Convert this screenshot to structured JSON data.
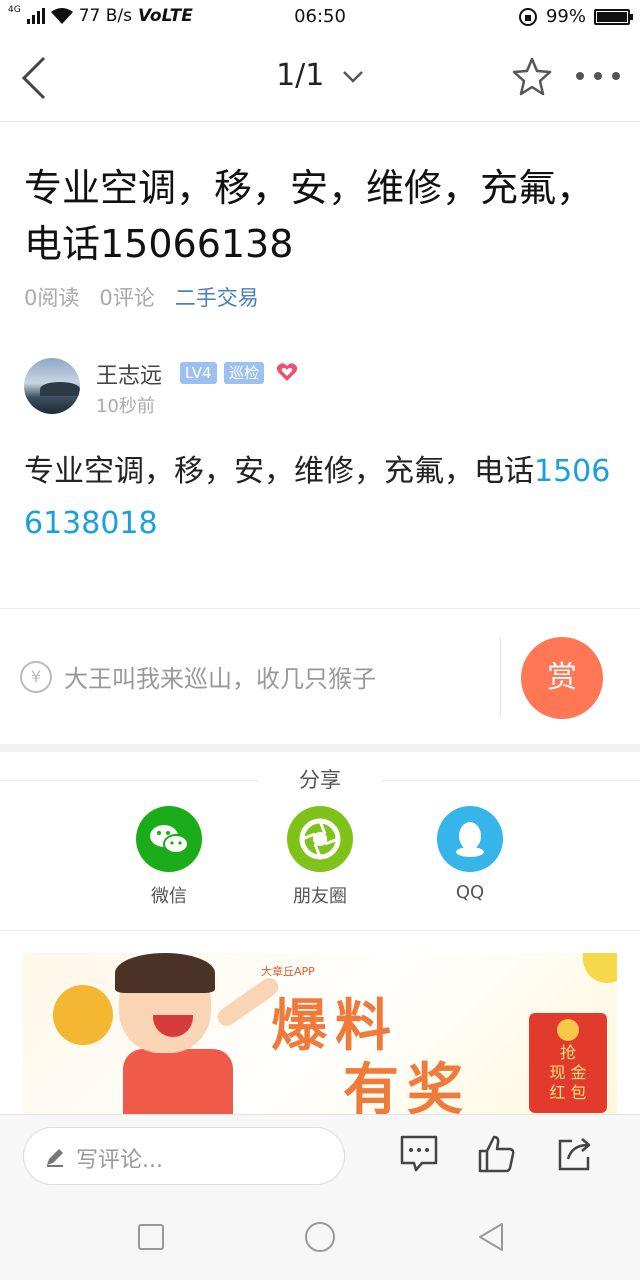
{
  "status_bar": {
    "network": "4G",
    "speed": "77 B/s",
    "volte": "VoLTE",
    "time": "06:50",
    "battery": "99%",
    "battery_level": 0.99
  },
  "header": {
    "pager": "1/1"
  },
  "article": {
    "title": "专业空调，移，安，维修，充氟，电话15066138",
    "reads": "0阅读",
    "comments": "0评论",
    "category": "二手交易",
    "author": {
      "name": "王志远",
      "level": "LV4",
      "role": "巡检",
      "time": "10秒前"
    },
    "content_text": "专业空调，移，安，维修，充氟，电话",
    "content_phone": "15066138018"
  },
  "reward": {
    "prompt": "大王叫我来巡山，收几只猴子",
    "button": "赏",
    "currency_symbol": "¥"
  },
  "share": {
    "title": "分享",
    "items": [
      {
        "label": "微信",
        "color": "#1aad19",
        "icon": "wechat-icon"
      },
      {
        "label": "朋友圈",
        "color": "#7fc31a",
        "icon": "moments-icon"
      },
      {
        "label": "QQ",
        "color": "#35b5ea",
        "icon": "qq-icon"
      }
    ]
  },
  "banner": {
    "brand": "大章丘APP",
    "line1": "爆料",
    "line2": "有奖",
    "red_packet": "抢\n现 金\n红 包"
  },
  "bottom_bar": {
    "comment_placeholder": "写评论..."
  },
  "colors": {
    "accent_link": "#1aa0e0",
    "category": "#4a7fbf",
    "reward": "#ff7755"
  }
}
